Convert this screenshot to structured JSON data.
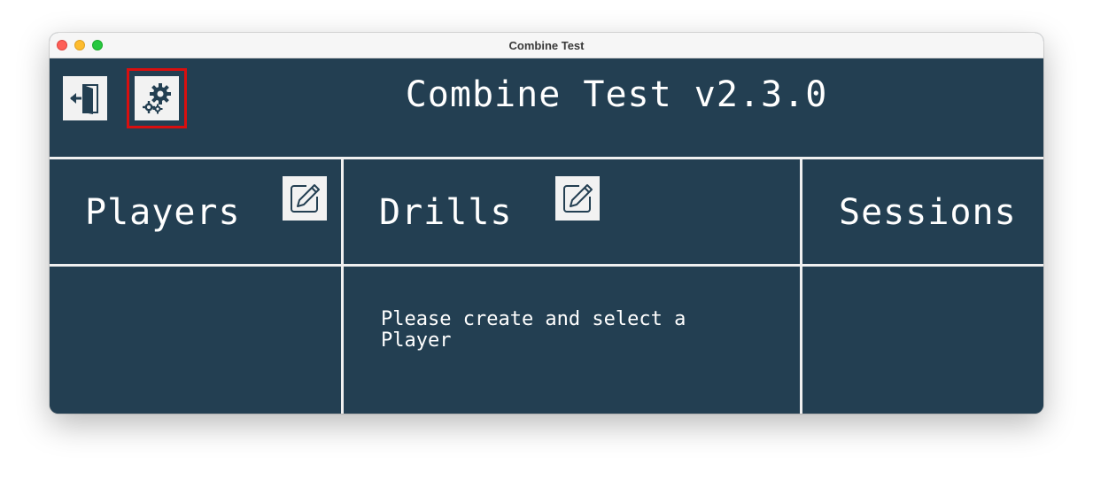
{
  "window": {
    "title": "Combine Test"
  },
  "header": {
    "app_title": "Combine Test v2.3.0",
    "exit_icon": "exit-door-icon",
    "settings_icon": "gears-icon"
  },
  "columns": [
    {
      "title": "Players",
      "edit_icon": "edit-pencil-icon",
      "message": ""
    },
    {
      "title": "Drills",
      "edit_icon": "edit-pencil-icon",
      "message": "Please create and select a Player"
    },
    {
      "title": "Sessions",
      "message": ""
    }
  ],
  "colors": {
    "background": "#233f52",
    "divider": "#f0f0f0",
    "highlight": "#d80f0f",
    "button_bg": "#f2f2f2",
    "icon": "#233f52"
  }
}
